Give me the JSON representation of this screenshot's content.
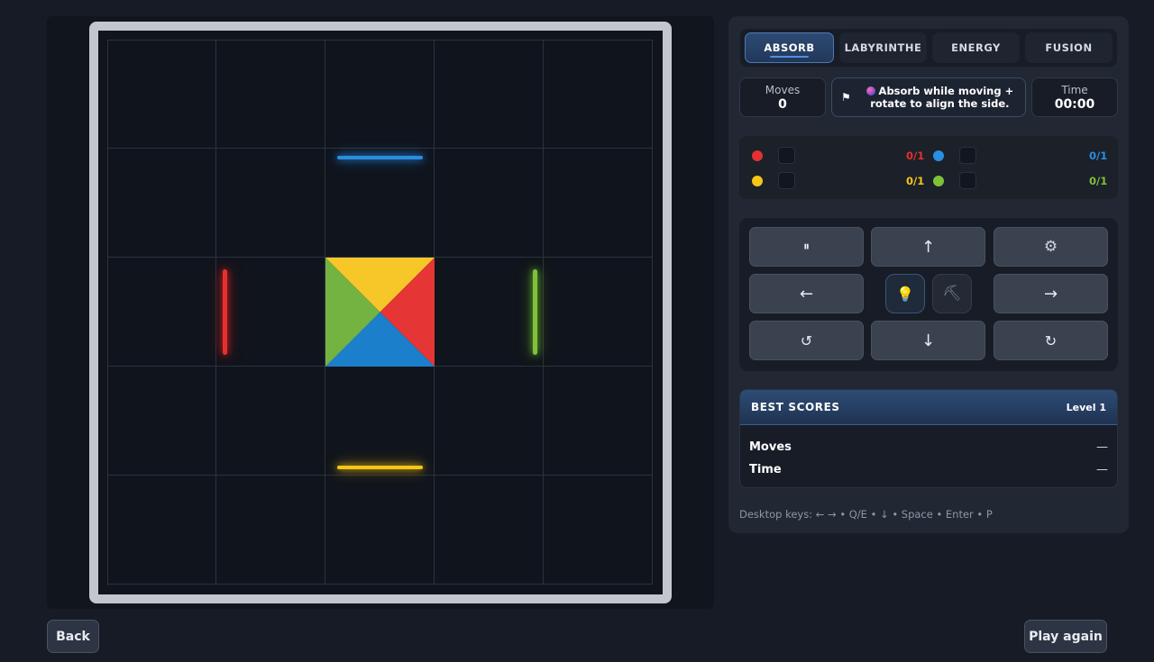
{
  "modes": [
    {
      "label": "ABSORB",
      "active": true
    },
    {
      "label": "LABYRINTHE",
      "active": false
    },
    {
      "label": "ENERGY",
      "active": false
    },
    {
      "label": "FUSION",
      "active": false
    }
  ],
  "stats": {
    "moves_label": "Moves",
    "moves_value": "0",
    "time_label": "Time",
    "time_value": "00:00"
  },
  "hint": {
    "flag_icon": "⚑",
    "text_line1": "Absorb while moving +",
    "text_line2": "rotate to align the side."
  },
  "goals": [
    {
      "color": "#e53030",
      "count": "0/1"
    },
    {
      "color": "#2a8ee0",
      "count": "0/1"
    },
    {
      "color": "#f5c518",
      "count": "0/1"
    },
    {
      "color": "#7fc13a",
      "count": "0/1"
    }
  ],
  "controls": {
    "pause": "⏸",
    "up": "↑",
    "settings": "⚙",
    "left": "←",
    "right": "→",
    "rotate_ccw": "↺",
    "down": "↓",
    "rotate_cw": "↻",
    "hint_icon": "💡",
    "pickaxe_icon": "⛏"
  },
  "scores": {
    "title": "BEST SCORES",
    "level": "Level 1",
    "moves_label": "Moves",
    "moves_value": "—",
    "time_label": "Time",
    "time_value": "—"
  },
  "keys_hint": "Desktop keys: ← → • Q/E • ↓ • Space • Enter • P",
  "buttons": {
    "back": "Back",
    "play_again": "Play again"
  },
  "board": {
    "size": 5,
    "piece_colors": {
      "top": "#f7c72a",
      "right": "#e53535",
      "bottom": "#1b7fcc",
      "left": "#74b342"
    }
  }
}
